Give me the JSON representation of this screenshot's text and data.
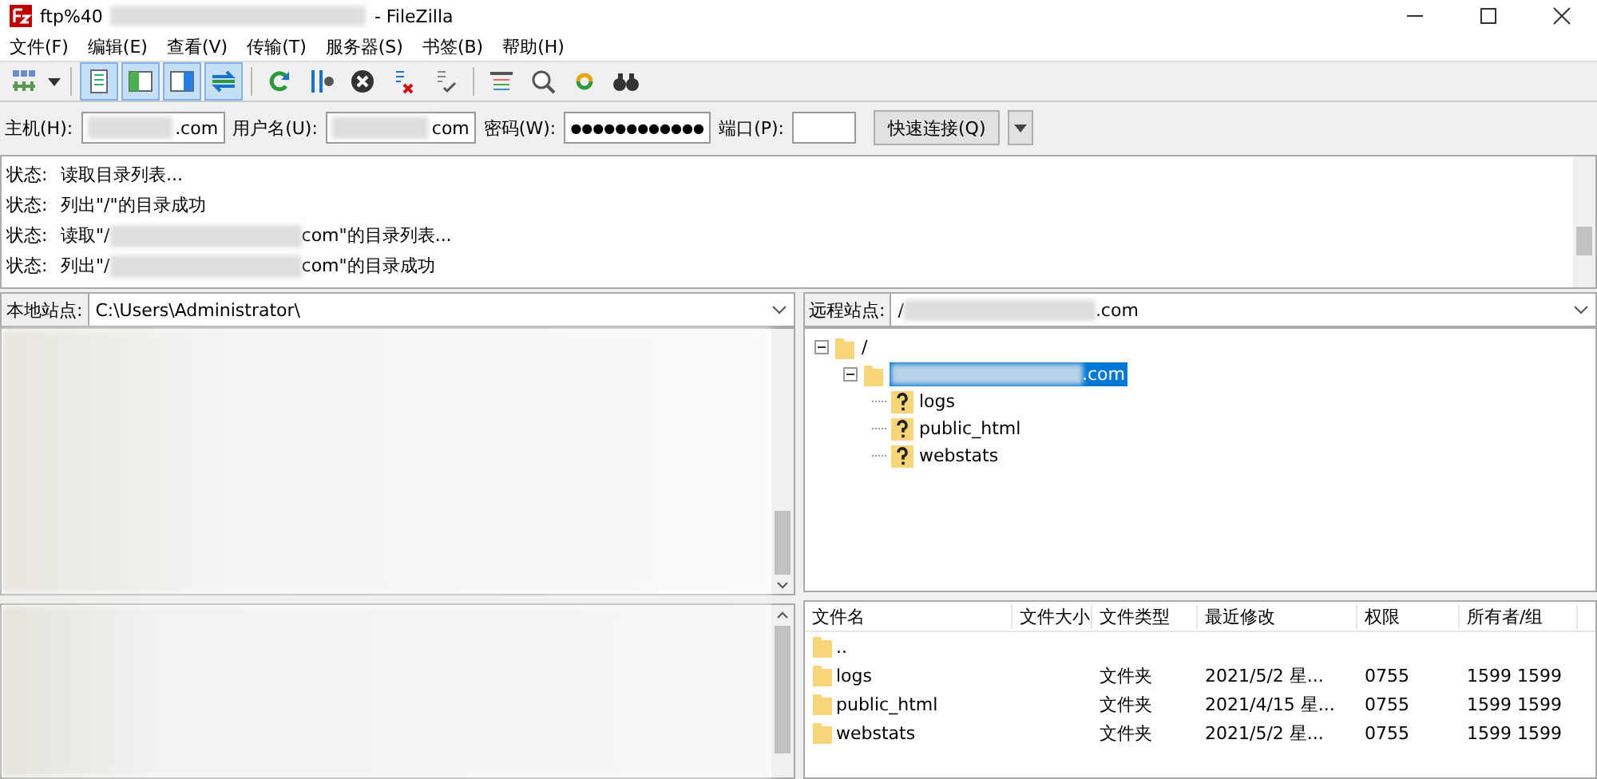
{
  "window": {
    "title_start": "ftp%40",
    "title_end": "- FileZilla"
  },
  "menu": [
    "文件(F)",
    "编辑(E)",
    "查看(V)",
    "传输(T)",
    "服务器(S)",
    "书签(B)",
    "帮助(H)"
  ],
  "toolbar": [
    {
      "buttons": [
        {
          "kind": "sitemanager"
        },
        {
          "kind": "dropdown"
        }
      ]
    },
    {
      "buttons": [
        {
          "kind": "log",
          "on": true
        },
        {
          "kind": "localtree",
          "on": true
        },
        {
          "kind": "remotetree",
          "on": true
        },
        {
          "kind": "queue",
          "on": true
        }
      ]
    },
    {
      "buttons": [
        {
          "kind": "refresh"
        },
        {
          "kind": "filter"
        },
        {
          "kind": "cancel"
        },
        {
          "kind": "disconnect"
        },
        {
          "kind": "reconnect"
        }
      ]
    },
    {
      "buttons": [
        {
          "kind": "dirlist"
        },
        {
          "kind": "search"
        },
        {
          "kind": "sync"
        },
        {
          "kind": "find"
        }
      ]
    }
  ],
  "quickconnect": {
    "host_label": "主机(H):",
    "host": ".com",
    "user_label": "用户名(U):",
    "user": "com",
    "pass_label": "密码(W):",
    "pass": "●●●●●●●●●●●●",
    "port_label": "端口(P):",
    "button": "快速连接(Q)"
  },
  "log": [
    {
      "label": "状态:",
      "before": "读取目录列表...",
      "redacted": false
    },
    {
      "label": "状态:",
      "before": "列出\"/\"的目录成功",
      "redacted": false
    },
    {
      "label": "状态:",
      "before": "读取\"/",
      "redacted": true,
      "after": "com\"的目录列表..."
    },
    {
      "label": "状态:",
      "before": "列出\"/",
      "redacted": true,
      "after": "com\"的目录成功"
    }
  ],
  "local": {
    "label": "本地站点:",
    "path": "C:\\Users\\Administrator\\"
  },
  "remote": {
    "label": "远程站点:",
    "path_start": "/",
    "path_end": ".com",
    "tree": [
      {
        "label": "/",
        "kind": "folder",
        "expanded": true,
        "selected": false,
        "redacted": false,
        "children": [
          {
            "label": ".com",
            "kind": "folder",
            "expanded": true,
            "selected": true,
            "redacted": true,
            "children": [
              {
                "label": "logs",
                "kind": "unknown",
                "selected": false,
                "redacted": false
              },
              {
                "label": "public_html",
                "kind": "unknown",
                "selected": false,
                "redacted": false
              },
              {
                "label": "webstats",
                "kind": "unknown",
                "selected": false,
                "redacted": false
              }
            ]
          }
        ]
      }
    ],
    "columns": [
      "文件名",
      "文件大小",
      "文件类型",
      "最近修改",
      "权限",
      "所有者/组"
    ],
    "rows": [
      {
        "name": ".."
      },
      {
        "name": "logs",
        "type": "文件夹",
        "modified": "2021/5/2 星...",
        "perm": "0755",
        "owner": "1599 1599"
      },
      {
        "name": "public_html",
        "type": "文件夹",
        "modified": "2021/4/15 星...",
        "perm": "0755",
        "owner": "1599 1599"
      },
      {
        "name": "webstats",
        "type": "文件夹",
        "modified": "2021/5/2 星...",
        "perm": "0755",
        "owner": "1599 1599"
      }
    ]
  }
}
